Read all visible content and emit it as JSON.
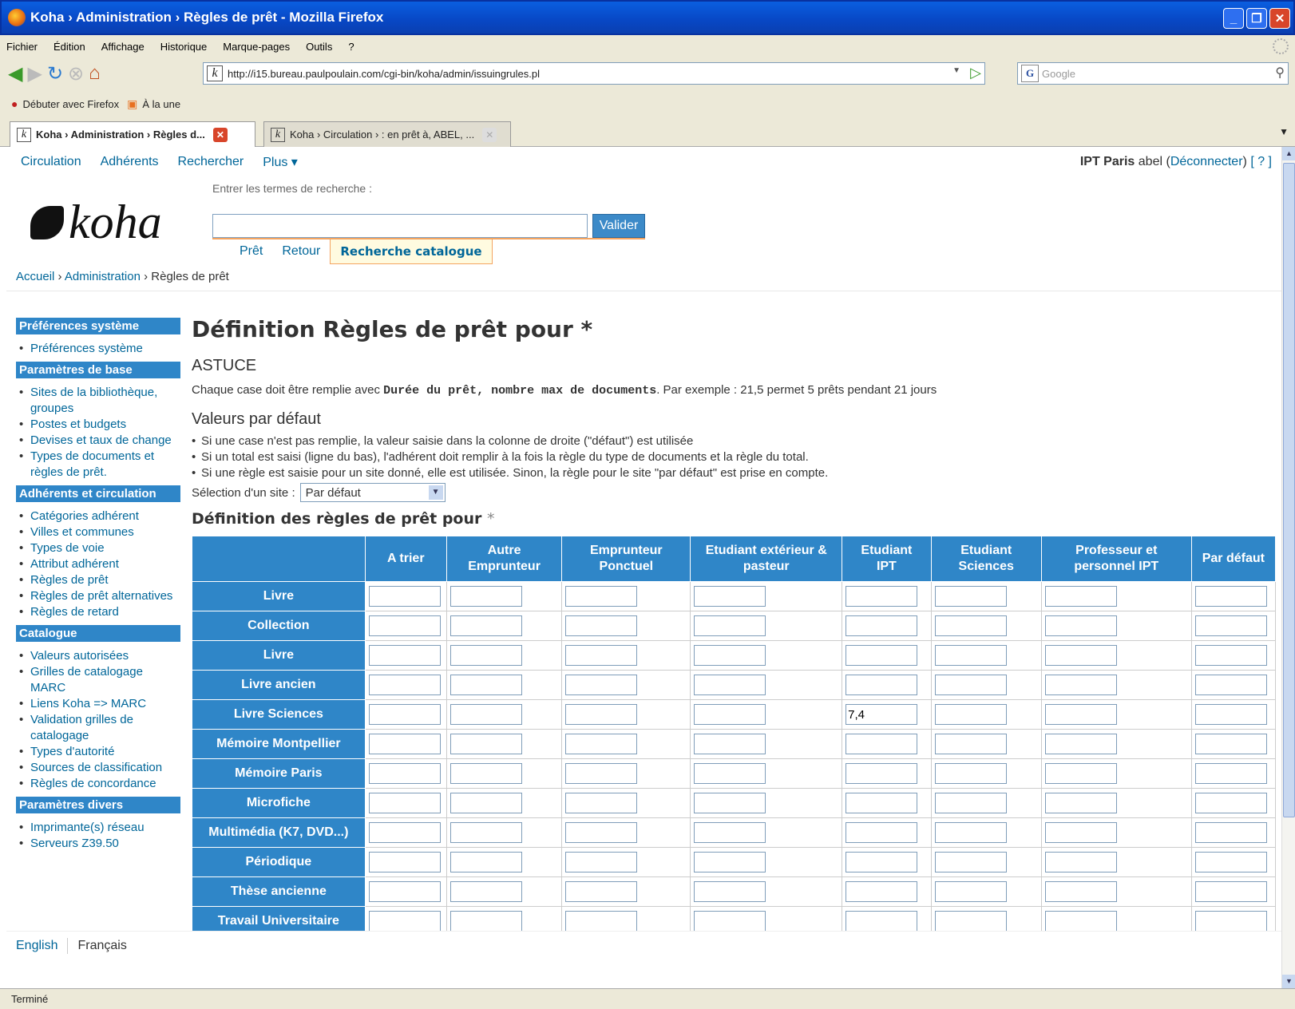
{
  "window": {
    "title": "Koha › Administration › Règles de prêt - Mozilla Firefox"
  },
  "menu": [
    "Fichier",
    "Édition",
    "Affichage",
    "Historique",
    "Marque-pages",
    "Outils",
    "?"
  ],
  "url": "http://i15.bureau.paulpoulain.com/cgi-bin/koha/admin/issuingrules.pl",
  "search_engine": {
    "placeholder": "Google"
  },
  "bookmarks": [
    "Débuter avec Firefox",
    "À la une"
  ],
  "tabs": [
    {
      "label": "Koha › Administration › Règles d..."
    },
    {
      "label": "Koha › Circulation › : en prêt à, ABEL, ..."
    }
  ],
  "topnav": {
    "items": [
      "Circulation",
      "Adhérents",
      "Rechercher",
      "Plus ▾"
    ],
    "branch": "IPT Paris",
    "user": "abel",
    "logout": "Déconnecter",
    "help": "[ ? ]"
  },
  "logo_text": "koha",
  "search": {
    "label": "Entrer les termes de recherche :",
    "button": "Valider",
    "tabs": [
      "Prêt",
      "Retour",
      "Recherche catalogue"
    ]
  },
  "breadcrumb": {
    "home": "Accueil",
    "admin": "Administration",
    "current": "Règles de prêt"
  },
  "sidebar": {
    "sections": [
      {
        "title": "Préférences système",
        "items": [
          "Préférences système"
        ]
      },
      {
        "title": "Paramètres de base",
        "items": [
          "Sites de la bibliothèque, groupes",
          "Postes et budgets",
          "Devises et taux de change",
          "Types de documents et règles de prêt."
        ]
      },
      {
        "title": "Adhérents et circulation",
        "items": [
          "Catégories adhérent",
          "Villes et communes",
          "Types de voie",
          "Attribut adhérent",
          "Règles de prêt",
          "Règles de prêt alternatives",
          "Règles de retard"
        ]
      },
      {
        "title": "Catalogue",
        "items": [
          "Valeurs autorisées",
          "Grilles de catalogage MARC",
          "Liens Koha => MARC",
          "Validation grilles de catalogage",
          "Types d'autorité",
          "Sources de classification",
          "Règles de concordance"
        ]
      },
      {
        "title": "Paramètres divers",
        "items": [
          "Imprimante(s) réseau",
          "Serveurs Z39.50"
        ]
      }
    ]
  },
  "main": {
    "title": "Définition Règles de prêt pour *",
    "astuce_title": "ASTUCE",
    "astuce_pre": "Chaque case doit être remplie avec ",
    "astuce_code": "Durée du prêt, nombre max de documents",
    "astuce_post": ". Par exemple : 21,5 permet 5 prêts pendant 21 jours",
    "defaults_title": "Valeurs par défaut",
    "defaults": [
      "Si une case n'est pas remplie, la valeur saisie dans la colonne de droite (\"défaut\") est utilisée",
      "Si un total est saisi (ligne du bas), l'adhérent doit remplir à la fois la règle du type de documents et la règle du total.",
      "Si une règle est saisie pour un site donné, elle est utilisée. Sinon, la règle pour le site \"par défaut\" est prise en compte."
    ],
    "site_label": "Sélection d'un site :",
    "site_value": "Par défaut",
    "table_title": "Définition des règles de prêt pour",
    "table_title_star": "*",
    "columns": [
      {
        "l1": "A trier",
        "l2": ""
      },
      {
        "l1": "Autre",
        "l2": "Emprunteur"
      },
      {
        "l1": "Emprunteur",
        "l2": "Ponctuel"
      },
      {
        "l1": "Etudiant extérieur &",
        "l2": "pasteur"
      },
      {
        "l1": "Etudiant",
        "l2": "IPT"
      },
      {
        "l1": "Etudiant",
        "l2": "Sciences"
      },
      {
        "l1": "Professeur et",
        "l2": "personnel IPT"
      },
      {
        "l1": "Par défaut",
        "l2": ""
      }
    ],
    "rows": [
      {
        "label": "Livre",
        "values": [
          "",
          "",
          "",
          "",
          "",
          "",
          "",
          ""
        ]
      },
      {
        "label": "Collection",
        "values": [
          "",
          "",
          "",
          "",
          "",
          "",
          "",
          ""
        ]
      },
      {
        "label": "Livre",
        "values": [
          "",
          "",
          "",
          "",
          "",
          "",
          "",
          ""
        ]
      },
      {
        "label": "Livre ancien",
        "values": [
          "",
          "",
          "",
          "",
          "",
          "",
          "",
          ""
        ]
      },
      {
        "label": "Livre Sciences",
        "values": [
          "",
          "",
          "",
          "",
          "7,4",
          "",
          "",
          ""
        ]
      },
      {
        "label": "Mémoire Montpellier",
        "values": [
          "",
          "",
          "",
          "",
          "",
          "",
          "",
          ""
        ]
      },
      {
        "label": "Mémoire Paris",
        "values": [
          "",
          "",
          "",
          "",
          "",
          "",
          "",
          ""
        ]
      },
      {
        "label": "Microfiche",
        "values": [
          "",
          "",
          "",
          "",
          "",
          "",
          "",
          ""
        ]
      },
      {
        "label": "Multimédia (K7, DVD...)",
        "values": [
          "",
          "",
          "",
          "",
          "",
          "",
          "",
          ""
        ]
      },
      {
        "label": "Périodique",
        "values": [
          "",
          "",
          "",
          "",
          "",
          "",
          "",
          ""
        ]
      },
      {
        "label": "Thèse ancienne",
        "values": [
          "",
          "",
          "",
          "",
          "",
          "",
          "",
          ""
        ]
      },
      {
        "label": "Travail Universitaire",
        "values": [
          "",
          "",
          "",
          "",
          "",
          "",
          "",
          ""
        ]
      }
    ]
  },
  "footer": {
    "english": "English",
    "french": "Français"
  },
  "status": "Terminé",
  "colors": {
    "accent": "#2f86c8",
    "link": "#006699",
    "titlebar": "#0a5fe0"
  }
}
